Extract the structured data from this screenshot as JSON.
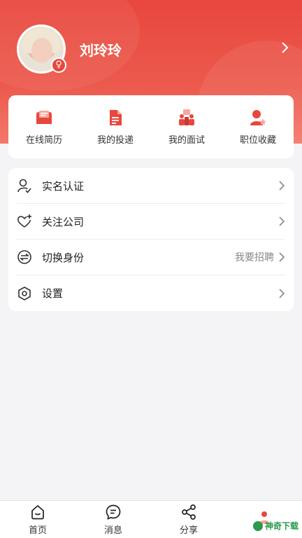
{
  "profile": {
    "username": "刘玲玲",
    "gender_symbol": "♀"
  },
  "quick_actions": [
    {
      "label": "在线简历",
      "icon": "resume-icon"
    },
    {
      "label": "我的投递",
      "icon": "document-icon"
    },
    {
      "label": "我的面试",
      "icon": "interview-icon"
    },
    {
      "label": "职位收藏",
      "icon": "favorite-user-icon"
    }
  ],
  "menu": [
    {
      "label": "实名认证",
      "right": "",
      "icon": "user-verify-icon"
    },
    {
      "label": "关注公司",
      "right": "",
      "icon": "heart-plus-icon"
    },
    {
      "label": "切换身份",
      "right": "我要招聘",
      "icon": "switch-icon"
    },
    {
      "label": "设置",
      "right": "",
      "icon": "settings-hexagon-icon"
    }
  ],
  "tabbar": [
    {
      "label": "首页",
      "icon": "home-icon"
    },
    {
      "label": "消息",
      "icon": "message-icon"
    },
    {
      "label": "分享",
      "icon": "share-icon"
    }
  ],
  "watermark": {
    "text": "神奇下载"
  },
  "colors": {
    "accent": "#e8473d",
    "background": "#f4f4f6"
  }
}
